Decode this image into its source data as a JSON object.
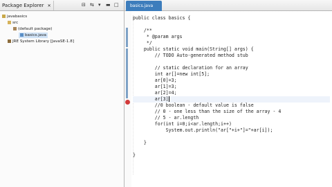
{
  "explorer": {
    "tab_label": "Package Explorer",
    "tree": [
      {
        "label": "javabasics",
        "indent": 0,
        "icon": "project"
      },
      {
        "label": "src",
        "indent": 1,
        "icon": "folder"
      },
      {
        "label": "(default package)",
        "indent": 2,
        "icon": "package"
      },
      {
        "label": "basics.java",
        "indent": 3,
        "icon": "java-file",
        "selected": true
      },
      {
        "label": "JRE System Library [JavaSE-1.8]",
        "indent": 1,
        "icon": "library"
      }
    ]
  },
  "editor": {
    "tab_label": "basics.java",
    "code_lines": [
      "public class basics {",
      "",
      "    /**",
      "     * @param args",
      "     */",
      "    public static void main(String[] args) {",
      "        // TODO Auto-generated method stub",
      "",
      "        // static declaration for an array",
      "        int ar[]=new int[5];",
      "        ar[0]=3;",
      "        ar[1]=3;",
      "        ar[2]=4;",
      "        ar[3]",
      "        //0 boolean - default value is false",
      "        // 0 - one less than the size of the array - 4",
      "        // 5 - ar.length",
      "        for(int i=0;i<ar.length;i++)",
      "            System.out.println(\"ar[\"+i+\"]=\"+ar[i]);",
      "",
      "    }",
      "",
      "}"
    ]
  },
  "colors": {
    "accent": "#3d7dbc",
    "fold": "#7ea2c6",
    "error": "#d23b3b"
  }
}
